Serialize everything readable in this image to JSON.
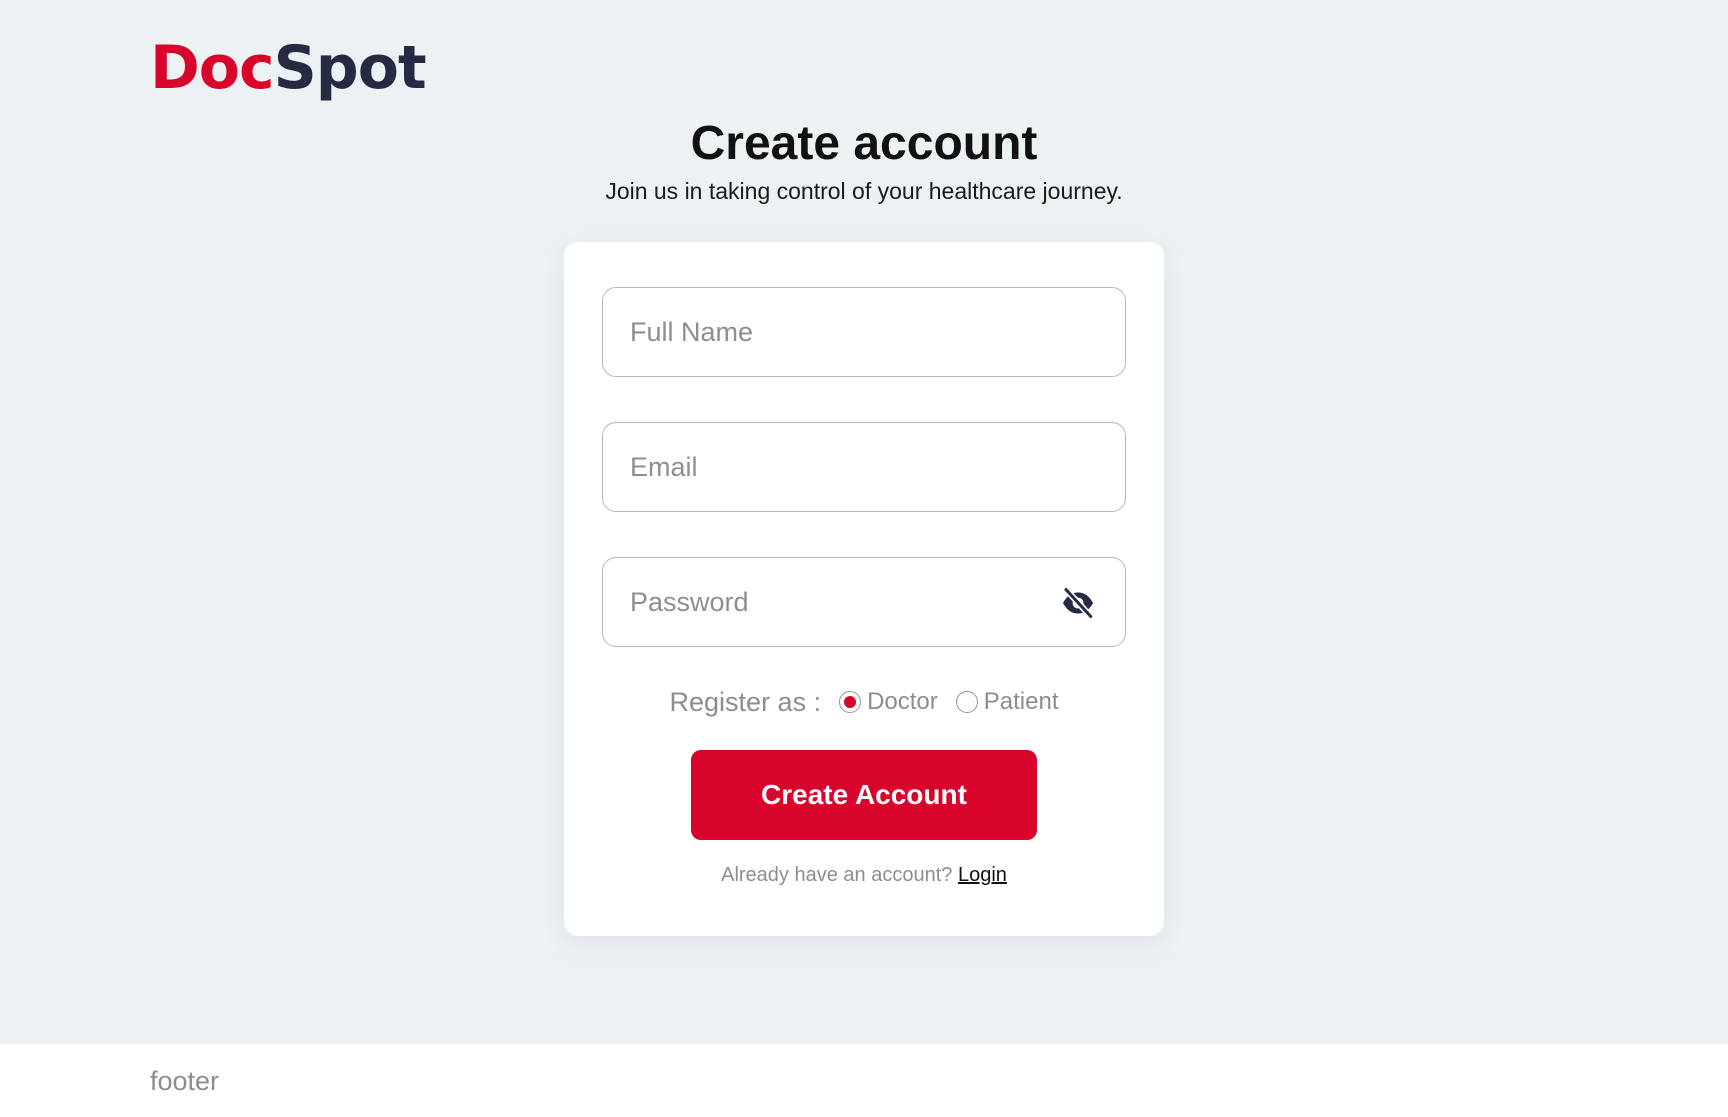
{
  "brand": {
    "part1": "Doc",
    "part2": "Spot"
  },
  "header": {
    "title": "Create account",
    "subtitle": "Join us in taking control of your healthcare journey."
  },
  "form": {
    "full_name": {
      "placeholder": "Full Name",
      "value": ""
    },
    "email": {
      "placeholder": "Email",
      "value": ""
    },
    "password": {
      "placeholder": "Password",
      "value": "",
      "toggle_icon": "eye-slash-icon"
    },
    "register_as": {
      "label": "Register as :",
      "options": [
        {
          "label": "Doctor",
          "selected": true
        },
        {
          "label": "Patient",
          "selected": false
        }
      ]
    },
    "submit_label": "Create Account",
    "login_prompt": "Already have an account?",
    "login_link": "Login"
  },
  "footer": {
    "text": "footer"
  },
  "colors": {
    "accent": "#d9042b",
    "brand_dark": "#262b43",
    "background": "#ecf1f4"
  }
}
